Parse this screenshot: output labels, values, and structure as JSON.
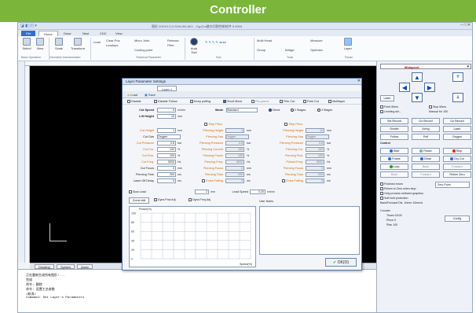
{
  "banner": {
    "title": "Controller"
  },
  "app": {
    "window_title": "图形 2019.0.0.0.SVN.HN.AE1 - CypCut激光切割控制软件 5.9924"
  },
  "menu_tabs": [
    {
      "label": "File"
    },
    {
      "label": "Home"
    },
    {
      "label": "Draw"
    },
    {
      "label": "Nest"
    },
    {
      "label": "CNC"
    },
    {
      "label": "View"
    }
  ],
  "ribbon": {
    "select": "Select",
    "view": "View",
    "scale": "Scale",
    "transform": "Transform",
    "lead": "Lead",
    "clear_pos": "Clear Pos",
    "lead_ops": "Leadops",
    "micro_joint": "Micro Joint",
    "release": "Release",
    "fillet": "Fillet",
    "cooling_point": "Cooling point",
    "auto_sort": "Auto Sort",
    "sort": "Sort",
    "multi_head": "Multi Head",
    "group": "Group",
    "bridge": "Bridge",
    "measure": "Measure",
    "optimize": "Optimize",
    "layer": "Layer",
    "basic_operation": "Basic Operation",
    "geometric_transformation": "Geometric transformation",
    "technical_parameter": "Technical Parameter",
    "tools": "Tools",
    "param": "Param"
  },
  "canvas_tabs": [
    {
      "label": "Drawing"
    },
    {
      "label": "System"
    },
    {
      "label": "Alarm"
    }
  ],
  "console": {
    "lines": [
      "正在重新生成所有图形!...",
      "完成",
      "命令: 删除",
      "命令: 设置工艺参数",
      "<取消>",
      "Command: Set Layer's Parameters"
    ]
  },
  "right_panel": {
    "speed_select": "Midspeed",
    "laser_label": "Laser",
    "point_label": "Point",
    "point_value": "50ms",
    "stop_label": "Stop",
    "stop_value": "50ms",
    "leveling_label": "Leveling shi...",
    "manual_label": "Manual Hz",
    "manual_value": "100",
    "buttons": {
      "set_record": "Set Record",
      "go_record": "Go Record",
      "go_record2": "Go Record",
      "shutter": "Shutter",
      "airing": "Airing",
      "laser": "Laser",
      "follow": "Follow",
      "puff": "Puff",
      "oxygen": "Oxygen"
    },
    "control_label": "Control",
    "control_buttons": {
      "start": "Start",
      "pause": "Pause",
      "stop": "Stop",
      "frame": "Frame",
      "clean": "Clean",
      "dry_cut": "Dry Cut",
      "loop": "Loop",
      "back_rs": "Back",
      "forward": "Forward",
      "return_zero": "Return Zero"
    },
    "checks": {
      "finished_return": "Finished return",
      "finished_return_val": "Zero Point",
      "return_zero_when_stop": "Return to Zero when stop",
      "only_process_selected": "Only process selected graphics",
      "soft_limit": "Soft limit protection",
      "backward_dis": "Back/Forward Dis.",
      "backward_val": "10mm",
      "backward_speed": "10mm/s"
    },
    "counter_label": "Counter",
    "times_label": "Times",
    "times_value": "0/100",
    "piece_label": "Piece",
    "piece_value": "0",
    "plan_label": "Plan",
    "plan_value": "100",
    "config_button": "Config"
  },
  "dialog": {
    "title": "Layer Parameter Settings",
    "layer_tabs": [
      {
        "label": "Layer 1"
      }
    ],
    "tool_load": "Load",
    "tool_save": "Save",
    "options": [
      "Disable",
      "Disable Follow",
      "Keep puffing",
      "Short Move",
      "Pre-pierce",
      "Film Cut",
      "Path Cut",
      "Multilayer"
    ],
    "fields": {
      "cut_speed_label": "Cut Speed",
      "cut_speed": "5",
      "cut_speed_unit": "m/min",
      "lift_height_label": "Lift Height",
      "lift_height": "10",
      "lift_height_unit": "mm",
      "cut_height_label": "Cut Height",
      "cut_height": "1",
      "cut_height_unit": "mm",
      "cut_gas_label": "Cut Gas",
      "cut_gas": "Oxygen",
      "cut_pressure_label": "Cut Pressure",
      "cut_pressure": "0.8",
      "cut_pressure_unit": "bar",
      "cut_current_label": "Cut Cur.",
      "cut_current": "100",
      "cut_current_unit": "%",
      "cut_power_label": "Cut Pow.",
      "cut_power": "100",
      "cut_power_unit": "%",
      "cut_freq_label": "Cut Freq.",
      "cut_freq": "5000",
      "cut_freq_unit": "Hz",
      "cut_focus_label": "Cut Focus",
      "cut_focus": "0",
      "cut_focus_unit": "mm",
      "piercing_time_label": "Piercing Time",
      "piercing_time": "200",
      "piercing_time_unit": "ms",
      "laser_off_delay_label": "Laser Off Delay",
      "laser_off_delay": "0",
      "laser_off_delay_unit": "ms"
    },
    "mode_label": "Mode",
    "mode_value": "Standard",
    "stage_direct": "Direct",
    "stage_two": "2 Stages",
    "stage_three": "3 Stages",
    "col2_labels": [
      "Step Pierc.",
      "Piercing Height",
      "Piercing Gas",
      "Piercing Pressure",
      "Piercing Current",
      "Piercing Power",
      "Piercing Freq.",
      "Piercing Focus",
      "Piercing Time",
      "Extra Puffing"
    ],
    "col2_values": [
      "",
      "4",
      "Oxygen",
      "0.8",
      "100",
      "100",
      "5000",
      "0",
      "200",
      "0"
    ],
    "col2_units": [
      "",
      "mm",
      "",
      "bar",
      "%",
      "%",
      "Hz",
      "mm",
      "ms",
      "ms"
    ],
    "col3_labels": [
      "Step Pierc.",
      "Piercing Height",
      "Piercing Gas",
      "Piercing Pressure",
      "Piercing Cur.",
      "Piercing Pow.",
      "Pulsed Freq.",
      "Piercing Focus",
      "Piercing Time",
      "Extra Puffing"
    ],
    "col3_values": [
      "",
      "10",
      "Oxygen",
      "0.8",
      "100",
      "100",
      "5000",
      "0",
      "200",
      "0"
    ],
    "col3_units": [
      "",
      "mm",
      "",
      "bar",
      "%",
      "%",
      "Hz",
      "mm",
      "ms",
      "ms"
    ],
    "slow_lead_label": "Slow Lead",
    "slow_lead": "2",
    "slow_lead_unit": "mm",
    "lead_speed_label": "Lead Speed",
    "lead_speed": "0.20",
    "lead_speed_unit": "m/min",
    "curve_edit": "Curve edit",
    "pow_adj": "Dyna Pow Adj",
    "freq_adj": "Dyna Freq Adj",
    "chart_ylabel": "Power(%)",
    "chart_xlabel": "Speed(%)",
    "chart_yticks": [
      "100",
      "80",
      "60",
      "40",
      "20",
      "0"
    ],
    "user_notes_label": "User Notes",
    "ok_button": "OK(O)"
  }
}
